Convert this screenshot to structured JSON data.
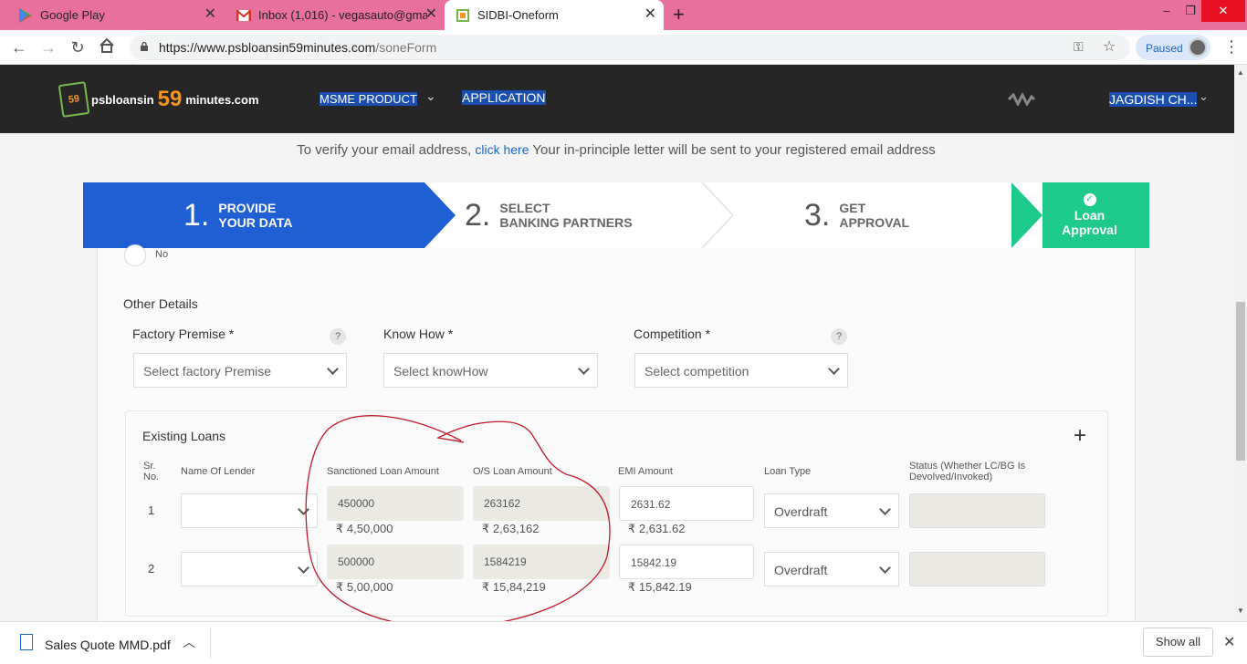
{
  "browser": {
    "tabs": [
      {
        "title": "Google Play"
      },
      {
        "title": "Inbox (1,016) - vegasauto@gmai"
      },
      {
        "title": "SIDBI-Oneform"
      }
    ],
    "url_host": "https://www.psbloansin59minutes.com",
    "url_path": "/soneForm",
    "paused_label": "Paused"
  },
  "header": {
    "logo_badge": "59",
    "logo_a": "psbloansin",
    "logo_59": "59",
    "logo_b": "minutes.com",
    "nav1": "MSME PRODUCT",
    "nav2": "APPLICATION",
    "user": "JAGDISH CH..."
  },
  "verify": {
    "before": "To verify your email address, ",
    "link": "click here",
    "after": " Your in-principle letter will be sent to your registered email address"
  },
  "steps": [
    {
      "num": "1.",
      "line1": "PROVIDE",
      "line2": "YOUR DATA"
    },
    {
      "num": "2.",
      "line1": "SELECT",
      "line2": "BANKING PARTNERS"
    },
    {
      "num": "3.",
      "line1": "GET",
      "line2": "APPROVAL"
    },
    {
      "line1": "Loan",
      "line2": "Approval"
    }
  ],
  "form": {
    "no_label": "No",
    "other_title": "Other Details",
    "fields": [
      {
        "label": "Factory Premise *",
        "placeholder": "Select factory Premise"
      },
      {
        "label": "Know How *",
        "placeholder": "Select knowHow"
      },
      {
        "label": "Competition *",
        "placeholder": "Select competition"
      }
    ]
  },
  "loans": {
    "title": "Existing Loans",
    "headers": {
      "sr": "Sr.\nNo.",
      "lender": "Name Of Lender",
      "sanctioned": "Sanctioned Loan Amount",
      "os": "O/S Loan Amount",
      "emi": "EMI Amount",
      "type": "Loan Type",
      "status": "Status (Whether LC/BG Is Devolved/Invoked)"
    },
    "rows": [
      {
        "sr": "1",
        "sanctioned": "450000",
        "sanctioned_fmt": "₹ 4,50,000",
        "os": "263162",
        "os_fmt": "₹ 2,63,162",
        "emi": "2631.62",
        "emi_fmt": "₹ 2,631.62",
        "type": "Overdraft"
      },
      {
        "sr": "2",
        "sanctioned": "500000",
        "sanctioned_fmt": "₹ 5,00,000",
        "os": "1584219",
        "os_fmt": "₹ 15,84,219",
        "emi": "15842.19",
        "emi_fmt": "₹ 15,842.19",
        "type": "Overdraft"
      }
    ]
  },
  "downloads": {
    "file": "Sales Quote MMD.pdf",
    "show_all": "Show all"
  },
  "colors": {
    "tabbar": "#e8709c",
    "step_active": "#1f5fd4",
    "step_done": "#1ec98c",
    "annotation": "#c0192b"
  }
}
